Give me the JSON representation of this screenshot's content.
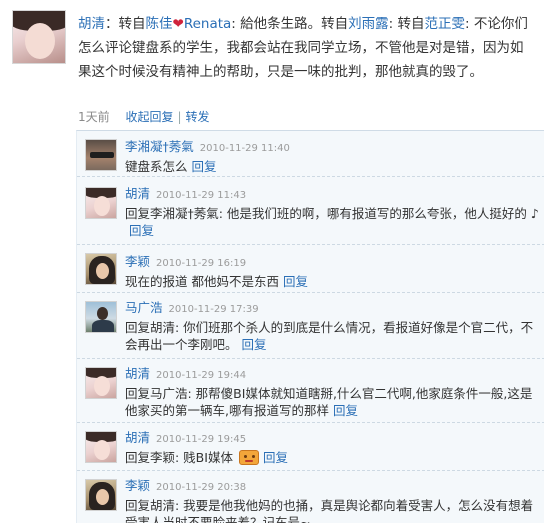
{
  "post": {
    "author": "胡清",
    "seg1": "：转自",
    "repost1_name": "陈佳",
    "heart": "❤",
    "repost1_suffix": "Renata",
    "seg2": ": 給他条生路。转自",
    "repost2_name": "刘雨露",
    "seg3": ": 转自",
    "repost3_name": "范正雯",
    "seg4": ": 不论你们怎么评论键盘系的学生，我都会站在我同学立场，不管他是对是错，因为如果这个时候没有精神上的帮助，只是一味的批判，那他就真的毁了。",
    "time": "1天前",
    "collapse_label": "收起回复",
    "separator": "|",
    "forward_label": "转发"
  },
  "comments": [
    {
      "name": "李湘凝†莠氣",
      "time": "2010-11-29 11:40",
      "text": "键盘系怎么",
      "reply": "回复",
      "avatar": "man-with-glasses"
    },
    {
      "name": "胡清",
      "time": "2010-11-29 11:43",
      "text": "回复李湘凝†莠氣: 他是我们班的啊，哪有报道写的那么夸张，他人挺好的",
      "note": "♪",
      "reply": "回复",
      "avatar": "girl"
    },
    {
      "name": "李颖",
      "time": "2010-11-29 16:19",
      "text": "现在的报道 都他妈不是东西",
      "reply": "回复",
      "avatar": "woman-long-hair"
    },
    {
      "name": "马广浩",
      "time": "2010-11-29 17:39",
      "text": "回复胡清: 你们班那个杀人的到底是什么情况，看报道好像是个官二代，不会再出一个李刚吧。",
      "reply": "回复",
      "avatar": "man-standing"
    },
    {
      "name": "胡清",
      "time": "2010-11-29 19:44",
      "text": "回复马广浩: 那帮傻BI媒体就知道瞎掰,什么官二代啊,他家庭条件一般,这是他家买的第一辆车,哪有报道写的那样",
      "reply": "回复",
      "avatar": "girl"
    },
    {
      "name": "胡清",
      "time": "2010-11-29 19:45",
      "text": "回复李颖: 贱BI媒体",
      "emoticon": "angry-face-emoticon",
      "reply": "回复",
      "avatar": "girl"
    },
    {
      "name": "李颖",
      "time": "2010-11-29 20:38",
      "text": "回复胡清: 我要是他我他妈的也捅，真是舆论都向着受害人，怎么没有想着受害人当时不要脸来着？记车号~",
      "reply": "",
      "avatar": "woman-long-hair"
    }
  ],
  "colors": {
    "link": "#2b6fb6",
    "panel": "#f4f8fb",
    "time": "#9b9b9b"
  }
}
